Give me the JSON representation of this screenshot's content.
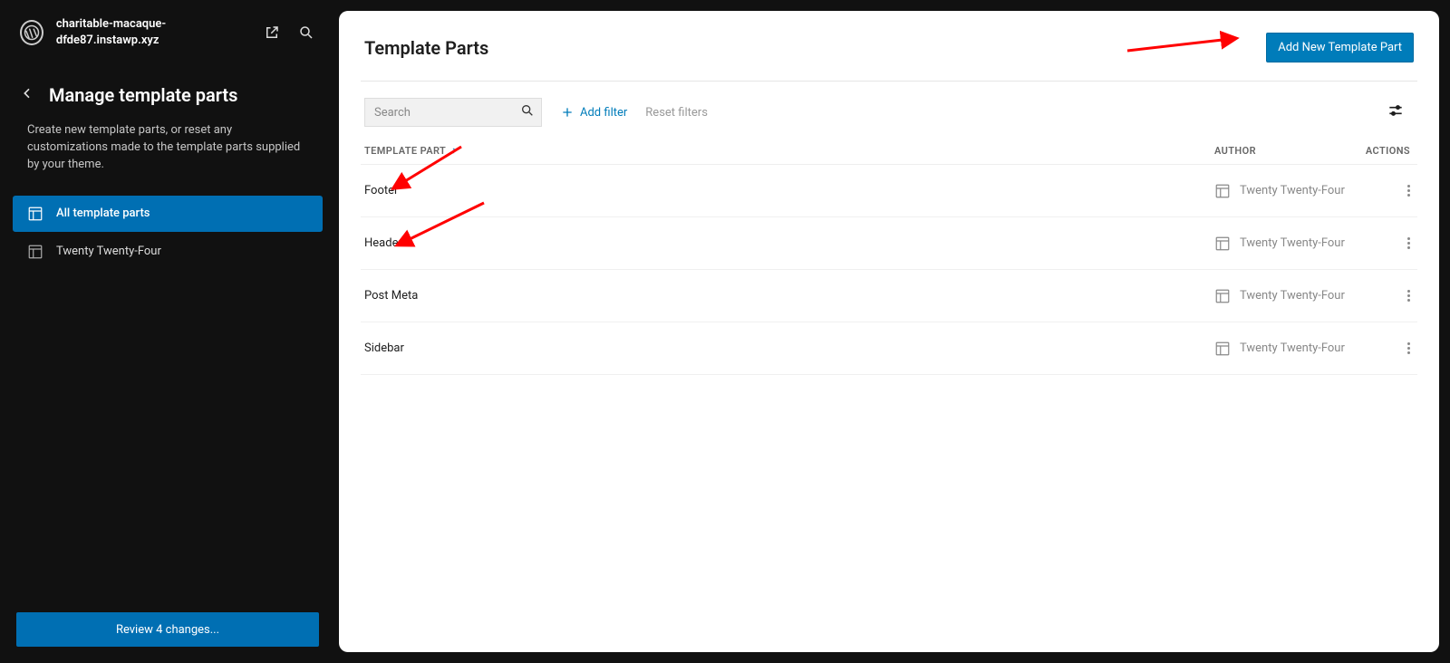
{
  "site": {
    "name": "charitable-macaque-dfde87.instawp.xyz"
  },
  "sidebar": {
    "title": "Manage template parts",
    "description": "Create new template parts, or reset any customizations made to the template parts supplied by your theme.",
    "items": [
      {
        "label": "All template parts",
        "active": true
      },
      {
        "label": "Twenty Twenty-Four",
        "active": false
      }
    ],
    "review_button": "Review 4 changes..."
  },
  "content": {
    "title": "Template Parts",
    "add_button": "Add New Template Part",
    "search_placeholder": "Search",
    "add_filter": "Add filter",
    "reset_filters": "Reset filters",
    "columns": {
      "template": "TEMPLATE PART",
      "author": "AUTHOR",
      "actions": "ACTIONS"
    },
    "rows": [
      {
        "name": "Footer",
        "author": "Twenty Twenty-Four"
      },
      {
        "name": "Header",
        "author": "Twenty Twenty-Four"
      },
      {
        "name": "Post Meta",
        "author": "Twenty Twenty-Four"
      },
      {
        "name": "Sidebar",
        "author": "Twenty Twenty-Four"
      }
    ]
  }
}
